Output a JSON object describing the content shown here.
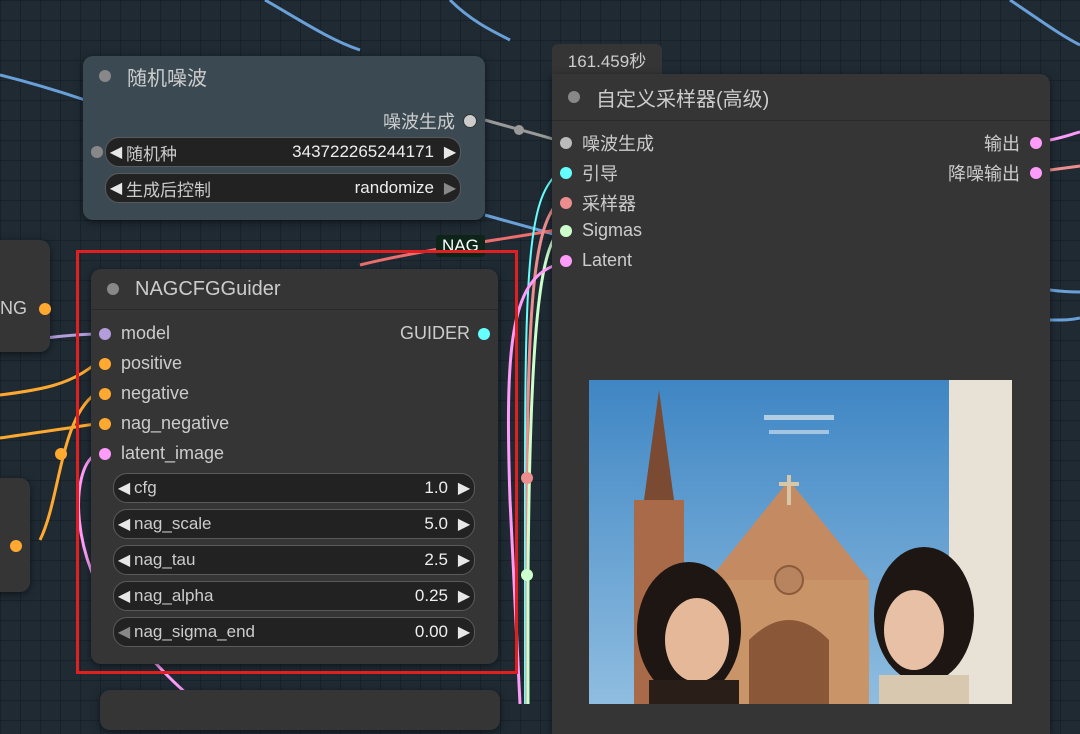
{
  "time_badge": "161.459秒",
  "noise_node": {
    "title": "随机噪波",
    "output": "噪波生成",
    "widgets": [
      {
        "label": "随机种",
        "value": "343722265244171"
      },
      {
        "label": "生成后控制",
        "value": "randomize"
      }
    ]
  },
  "sampler_node": {
    "title": "自定义采样器(高级)",
    "inputs": [
      "噪波生成",
      "引导",
      "采样器",
      "Sigmas",
      "Latent"
    ],
    "outputs": [
      "输出",
      "降噪输出"
    ]
  },
  "nag_label": "NAG",
  "guider_node": {
    "title": "NAGCFGGuider",
    "output": "GUIDER",
    "inputs": [
      "model",
      "positive",
      "negative",
      "nag_negative",
      "latent_image"
    ],
    "widgets": [
      {
        "label": "cfg",
        "value": "1.0"
      },
      {
        "label": "nag_scale",
        "value": "5.0"
      },
      {
        "label": "nag_tau",
        "value": "2.5"
      },
      {
        "label": "nag_alpha",
        "value": "0.25"
      },
      {
        "label": "nag_sigma_end",
        "value": "0.00"
      }
    ]
  },
  "left_partial_node": {
    "output_fragment": "NG"
  },
  "colors": {
    "node_bg": "#353535",
    "canvas_bg": "#1f2a33",
    "highlight_border": "#e02020",
    "model_port": "#b39ddb",
    "conditioning_port": "#ffa931",
    "latent_port": "#ff9cf9",
    "guider_port": "#66ffff",
    "noise_port": "#bbbbbb",
    "sampler_port": "#ec8e8e",
    "sigmas_port": "#cdffcd"
  }
}
